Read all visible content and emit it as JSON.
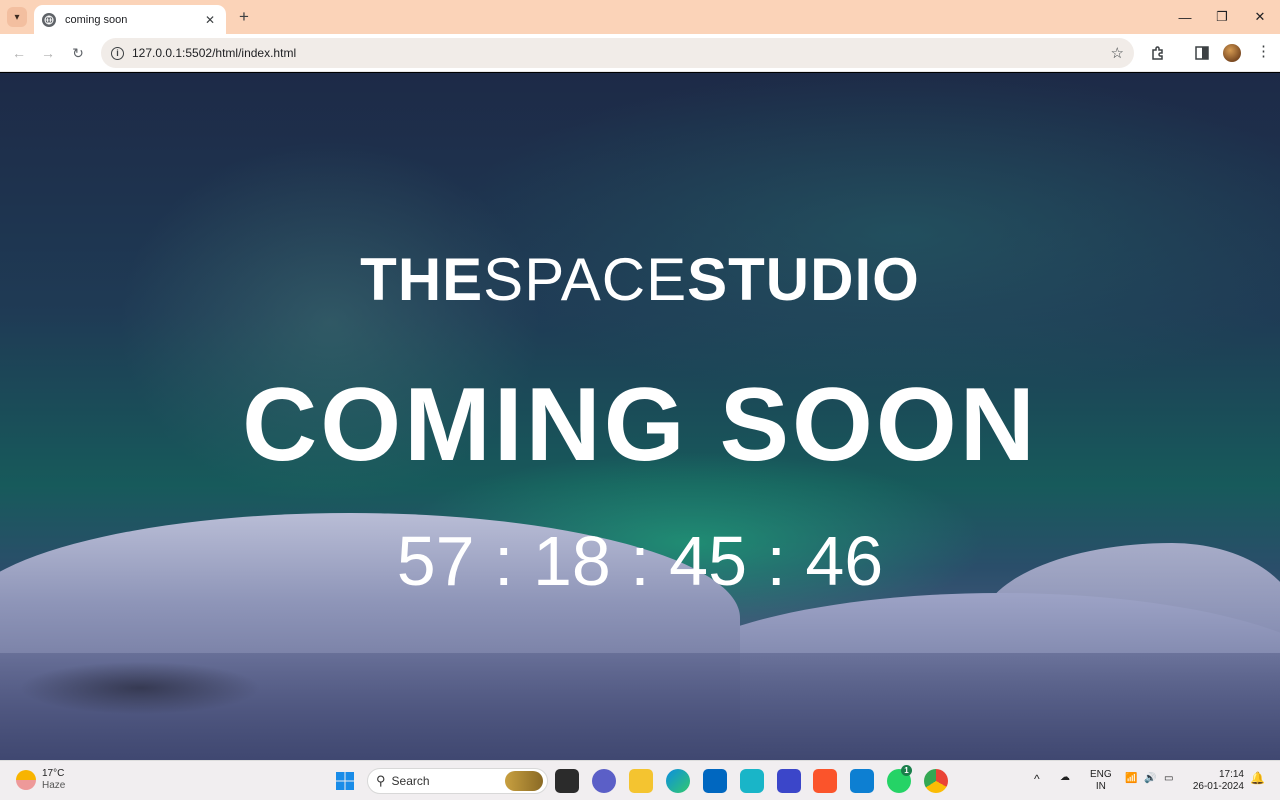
{
  "browser": {
    "tab_title": "coming soon",
    "url": "127.0.0.1:5502/html/index.html"
  },
  "page": {
    "brand_bold_1": "THE",
    "brand_light": "SPACE",
    "brand_bold_2": "STUDIO",
    "headline": "COMING SOON",
    "countdown": "57 : 18 : 45 : 46"
  },
  "taskbar": {
    "weather_temp": "17°C",
    "weather_condition": "Haze",
    "search_label": "Search",
    "whatsapp_badge": "1",
    "lang_top": "ENG",
    "lang_bottom": "IN",
    "time": "17:14",
    "date": "26-01-2024"
  }
}
